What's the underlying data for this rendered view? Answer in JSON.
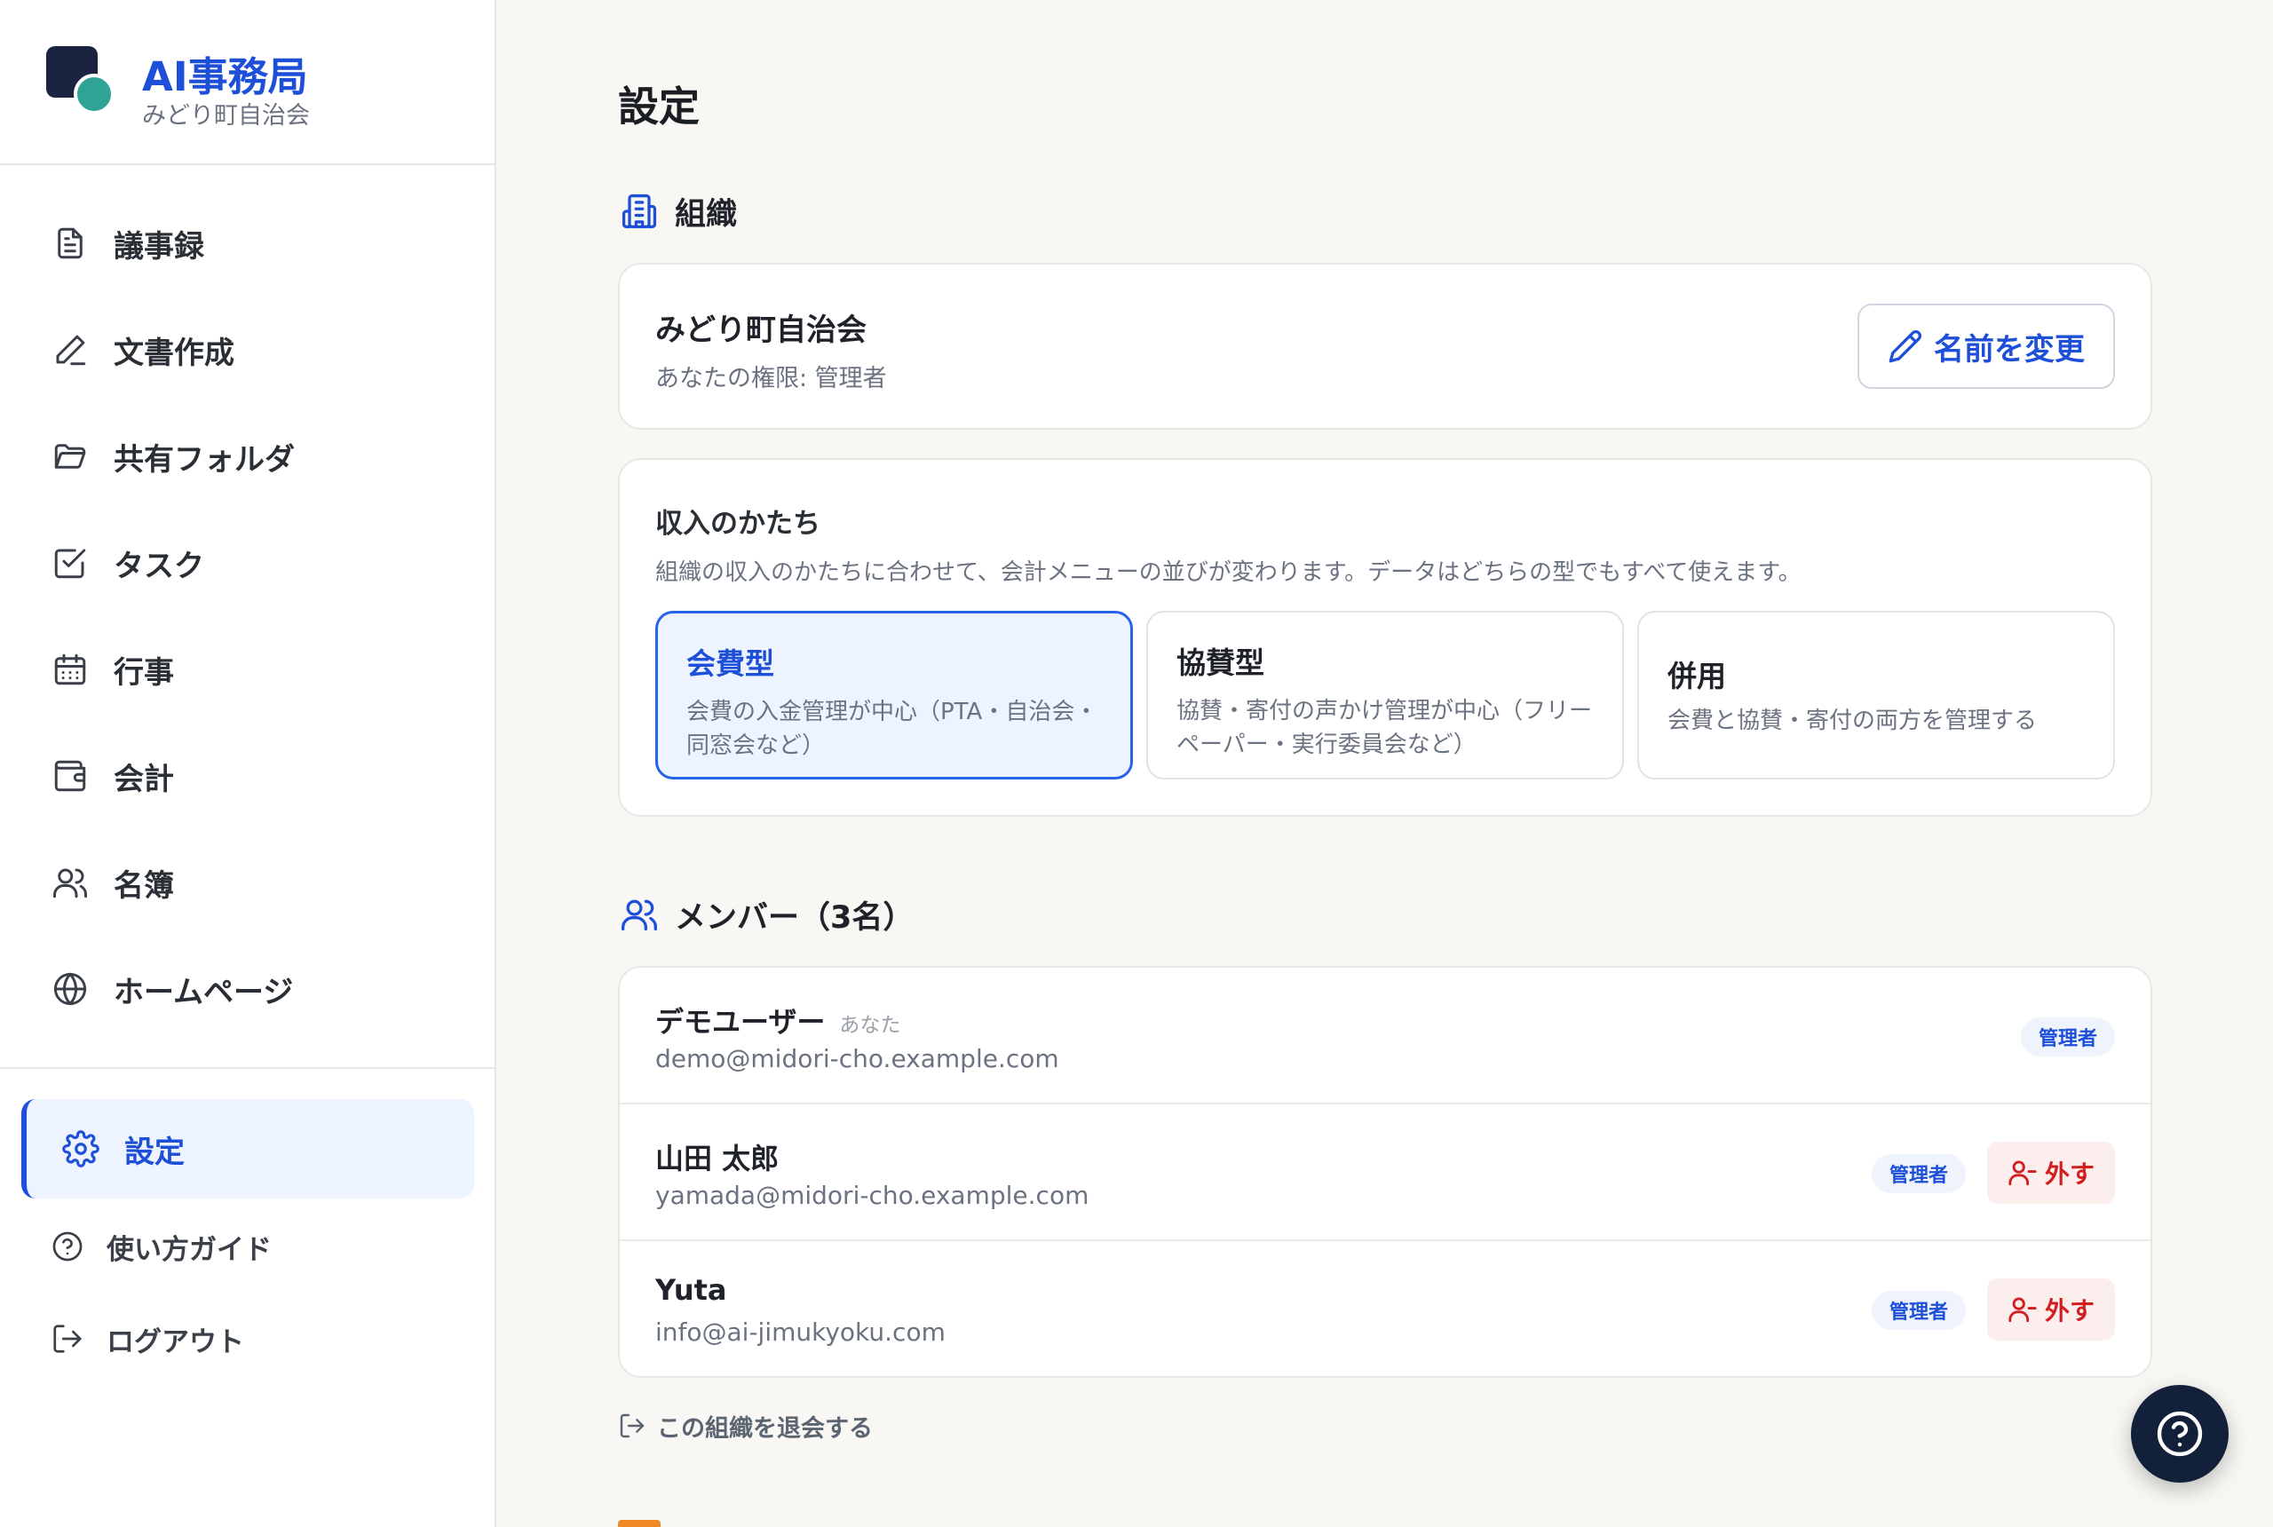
{
  "brand": {
    "title": "AI事務局",
    "subtitle": "みどり町自治会"
  },
  "nav": {
    "items": [
      {
        "label": "議事録",
        "icon": "document-icon"
      },
      {
        "label": "文書作成",
        "icon": "pen-icon"
      },
      {
        "label": "共有フォルダ",
        "icon": "folder-icon"
      },
      {
        "label": "タスク",
        "icon": "checkbox-icon"
      },
      {
        "label": "行事",
        "icon": "calendar-icon"
      },
      {
        "label": "会計",
        "icon": "wallet-icon"
      },
      {
        "label": "名簿",
        "icon": "users-icon"
      },
      {
        "label": "ホームページ",
        "icon": "globe-icon"
      }
    ],
    "active": {
      "label": "設定",
      "icon": "gear-icon"
    },
    "footer": [
      {
        "label": "使い方ガイド",
        "icon": "help-circle-icon"
      },
      {
        "label": "ログアウト",
        "icon": "logout-icon"
      }
    ]
  },
  "page": {
    "title": "設定"
  },
  "organization": {
    "heading": "組織",
    "name": "みどり町自治会",
    "role": "あなたの権限: 管理者",
    "rename_label": "名前を変更"
  },
  "income": {
    "title": "収入のかたち",
    "description": "組織の収入のかたちに合わせて、会計メニューの並びが変わります。データはどちらの型でもすべて使えます。",
    "options": [
      {
        "title": "会費型",
        "description": "会費の入金管理が中心（PTA・自治会・同窓会など）",
        "selected": true
      },
      {
        "title": "協賛型",
        "description": "協賛・寄付の声かけ管理が中心（フリーペーパー・実行委員会など）",
        "selected": false
      },
      {
        "title": "併用",
        "description": "会費と協賛・寄付の両方を管理する",
        "selected": false
      }
    ]
  },
  "members": {
    "heading": "メンバー（3名）",
    "you_label": "あなた",
    "remove_label": "外す",
    "list": [
      {
        "name": "デモユーザー",
        "email": "demo@midori-cho.example.com",
        "role": "管理者",
        "is_you": true
      },
      {
        "name": "山田 太郎",
        "email": "yamada@midori-cho.example.com",
        "role": "管理者",
        "is_you": false
      },
      {
        "name": "Yuta",
        "email": "info@ai-jimukyoku.com",
        "role": "管理者",
        "is_you": false
      }
    ]
  },
  "leave_label": "この組織を退会する",
  "colors": {
    "accent": "#1d4fd8",
    "danger": "#d11f1f",
    "brand_dark": "#1a2440",
    "brand_teal": "#2fa394"
  }
}
